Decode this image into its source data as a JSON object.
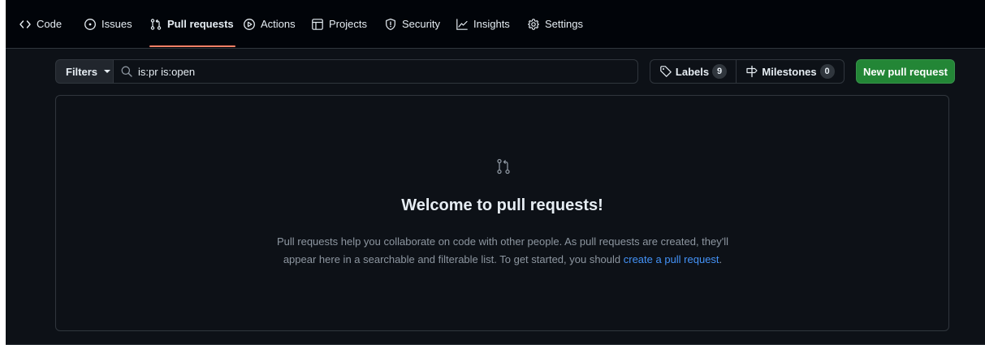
{
  "nav": {
    "items": [
      {
        "label": "Code",
        "icon": "code-icon"
      },
      {
        "label": "Issues",
        "icon": "issue-opened-icon"
      },
      {
        "label": "Pull requests",
        "icon": "git-pull-request-icon",
        "active": true
      },
      {
        "label": "Actions",
        "icon": "play-icon"
      },
      {
        "label": "Projects",
        "icon": "table-icon"
      },
      {
        "label": "Security",
        "icon": "shield-icon"
      },
      {
        "label": "Insights",
        "icon": "graph-icon"
      },
      {
        "label": "Settings",
        "icon": "gear-icon"
      }
    ],
    "active_underline_color": "#f78166"
  },
  "toolbar": {
    "filters_label": "Filters",
    "search_value": "is:pr is:open",
    "labels_label": "Labels",
    "labels_count": "9",
    "milestones_label": "Milestones",
    "milestones_count": "0",
    "new_pr_label": "New pull request"
  },
  "blankslate": {
    "icon": "git-pull-request-icon",
    "title": "Welcome to pull requests!",
    "body_line1": "Pull requests help you collaborate on code with other people. As pull requests are created, they'll",
    "body_line2_prefix": "appear here in a searchable and filterable list. To get started, you should ",
    "body_link": "create a pull request",
    "body_suffix": "."
  },
  "colors": {
    "background": "#0d1117",
    "header": "#010409",
    "border": "#30363d",
    "text": "#e6edf3",
    "muted": "#8d96a0",
    "accent_link": "#4493f8",
    "primary_button": "#238636"
  }
}
